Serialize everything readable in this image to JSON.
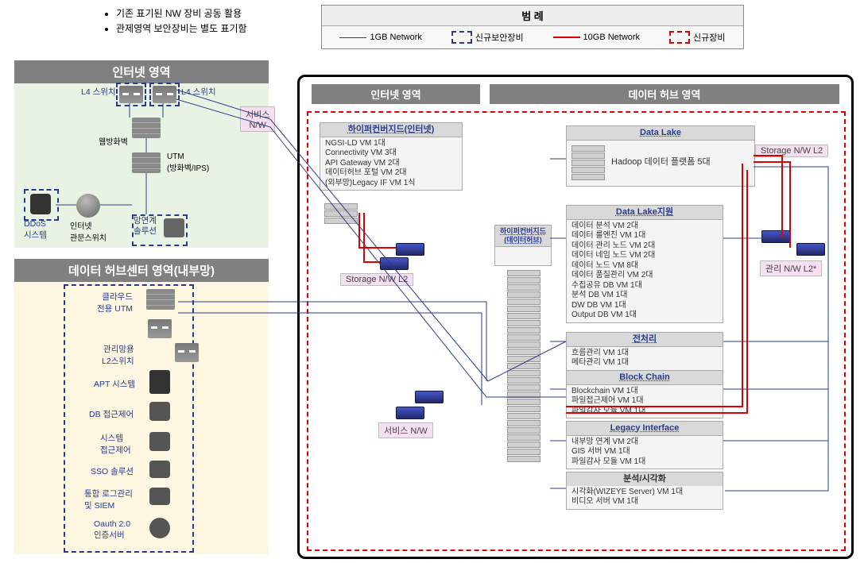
{
  "bullets": {
    "b1": "기존 표기된 NW 장비 공동 활용",
    "b2": "관제영역 보안장비는 별도 표기함"
  },
  "legend": {
    "title": "범 례",
    "i1": "1GB Network",
    "i2": "신규보안장비",
    "i3": "10GB Network",
    "i4": "신규장비"
  },
  "zones": {
    "internet_left": "인터넷 영역",
    "hubcenter": "데이터 허브센터 영역(내부망)",
    "internet_right": "인터넷 영역",
    "datahub": "데이터 허브 영역"
  },
  "left": {
    "l4_left": "L4 스위치",
    "l4_right": "L4 스위치",
    "web_fw": "웹방화벽",
    "utm": "UTM\n(방화벽/IPS)",
    "ddos": "DDoS\n시스템",
    "switch": "인터넷\n관문스위치",
    "linker": "망연계\n솔루션",
    "cloud_utm": "클라우드\n전용 UTM",
    "mgmt_l2": "관리망용\nL2스위치",
    "apt": "APT 시스템",
    "db_access": "DB 접근제어",
    "sys_access": "시스템\n접근제어",
    "sso": "SSO 솔루션",
    "siem": "통합 로그관리\n및 SIEM",
    "oauth": "Oauth 2.0\n인증서버"
  },
  "tags": {
    "service_nw_top": "서비스\nN/W",
    "storage_nw_l2_left": "Storage N/W L2",
    "service_nw_mid": "서비스 N/W",
    "storage_nw_l2_right": "Storage N/W L2",
    "mgmt_nw_l2": "관리 N/W L2*"
  },
  "hci_inet": {
    "title": "하이퍼컨버지드(인터넷)",
    "lines": [
      "NGSI-LD  VM 1대",
      "Connectivity VM 3대",
      "API Gateway VM 2대",
      "데이터허브 포털 VM 2대",
      "(외부망)Legacy IF VM 1식"
    ]
  },
  "hci_hub": {
    "title": "하이퍼컨버지드(데이터허브)"
  },
  "datalake": {
    "title": "Data Lake",
    "body": "Hadoop 데이터 플랫폼 5대"
  },
  "support": {
    "title": "Data Lake지원",
    "lines": [
      "데이터 분석 VM 2대",
      "데이터 룰엔진 VM 1대",
      "데이터 관리 노드 VM 2대",
      "데이터 네임 노드 VM 2대",
      "데이터 노드 VM 8대",
      "데이터 품질관리 VM 2대",
      "수집공유 DB VM 1대",
      "분석 DB VM 1대",
      "DW DB VM 1대",
      "Output DB VM 1대"
    ]
  },
  "prep": {
    "title": "전처리",
    "lines": [
      "흐름관리 VM 1대",
      "메타관리 VM 1대"
    ]
  },
  "bc": {
    "title": "Block Chain",
    "lines": [
      "Blockchain VM 1대",
      "파일접근제어 VM 1대",
      "파일감사 모듈 VM 1대"
    ]
  },
  "legacy": {
    "title": "Legacy Interface",
    "lines": [
      "내부망 연계 VM 2대",
      "GIS 서버 VM 1대",
      "파일감사 모듈 VM 1대"
    ]
  },
  "viz": {
    "title": "분석/시각화",
    "lines": [
      "시각화(WIZEYE Server) VM 1대",
      "비디오 서버 VM 1대"
    ]
  }
}
